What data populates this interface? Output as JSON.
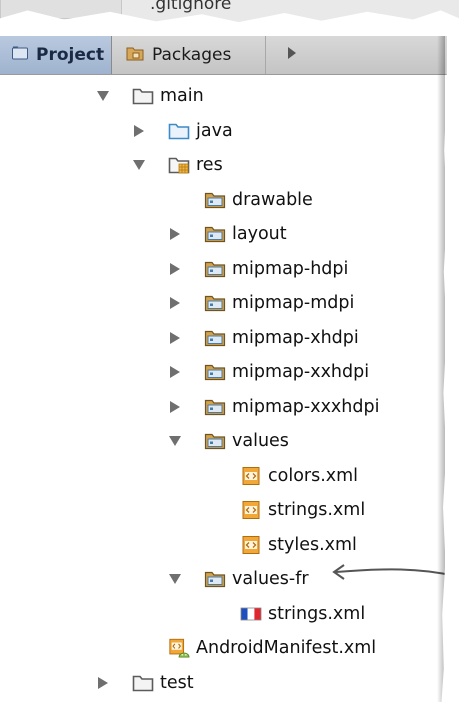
{
  "header": {
    "hidden_tab_label": ".gitignore"
  },
  "tabs": [
    {
      "label": "Project",
      "icon": "project-icon"
    },
    {
      "label": "Packages",
      "icon": "packages-icon"
    }
  ],
  "more_tabs_icon": "chevron-right-icon",
  "tree": [
    {
      "label": "main",
      "depth": 0,
      "arrow": "down",
      "icon": "folder-icon"
    },
    {
      "label": "java",
      "depth": 1,
      "arrow": "right",
      "icon": "source-folder-icon"
    },
    {
      "label": "res",
      "depth": 1,
      "arrow": "down",
      "icon": "resource-folder-icon"
    },
    {
      "label": "drawable",
      "depth": 2,
      "arrow": "none",
      "icon": "package-folder-icon"
    },
    {
      "label": "layout",
      "depth": 2,
      "arrow": "right",
      "icon": "package-folder-icon"
    },
    {
      "label": "mipmap-hdpi",
      "depth": 2,
      "arrow": "right",
      "icon": "package-folder-icon"
    },
    {
      "label": "mipmap-mdpi",
      "depth": 2,
      "arrow": "right",
      "icon": "package-folder-icon"
    },
    {
      "label": "mipmap-xhdpi",
      "depth": 2,
      "arrow": "right",
      "icon": "package-folder-icon"
    },
    {
      "label": "mipmap-xxhdpi",
      "depth": 2,
      "arrow": "right",
      "icon": "package-folder-icon"
    },
    {
      "label": "mipmap-xxxhdpi",
      "depth": 2,
      "arrow": "right",
      "icon": "package-folder-icon"
    },
    {
      "label": "values",
      "depth": 2,
      "arrow": "down",
      "icon": "package-folder-icon"
    },
    {
      "label": "colors.xml",
      "depth": 3,
      "arrow": "none",
      "icon": "xml-file-icon"
    },
    {
      "label": "strings.xml",
      "depth": 3,
      "arrow": "none",
      "icon": "xml-file-icon"
    },
    {
      "label": "styles.xml",
      "depth": 3,
      "arrow": "none",
      "icon": "xml-file-icon"
    },
    {
      "label": "values-fr",
      "depth": 2,
      "arrow": "down",
      "icon": "package-folder-icon"
    },
    {
      "label": "strings.xml",
      "depth": 3,
      "arrow": "none",
      "icon": "french-flag-icon"
    },
    {
      "label": "AndroidManifest.xml",
      "depth": 1,
      "arrow": "none",
      "icon": "android-manifest-icon"
    },
    {
      "label": "test",
      "depth": 0,
      "arrow": "right",
      "icon": "folder-icon"
    },
    {
      "label": "",
      "depth": 0,
      "arrow": "none",
      "icon": "file-icon"
    }
  ],
  "colors": {
    "folder": "#6b6b6b",
    "source_folder": "#4a90c8",
    "package_folder": "#7aa9d4",
    "xml": "#e89a2c",
    "selected_tab": "#a6b8d2"
  }
}
